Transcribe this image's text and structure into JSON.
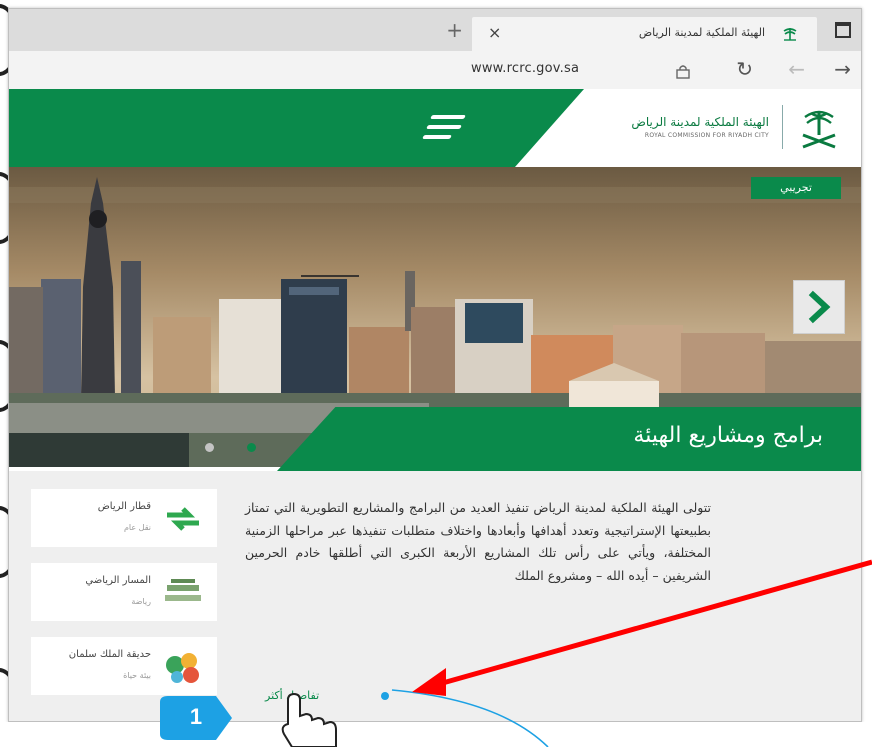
{
  "browser": {
    "tab_title": "الهيئة الملكية لمدينة الرياض",
    "url": "www.rcrc.gov.sa",
    "close_glyph": "×",
    "newtab_glyph": "+",
    "nav_icons": [
      "forward-icon",
      "back-icon",
      "refresh-icon",
      "lock-icon"
    ]
  },
  "site": {
    "logo_ar": "الهيئة الملكية لمدينة الرياض",
    "logo_en": "ROYAL COMMISSION FOR RIYADH CITY",
    "hero_tag": "تجريبي",
    "banner_title": "برامج ومشاريع الهيئة",
    "paragraph": "تتولى الهيئة الملكية لمدينة الرياض تنفيذ العديد من البرامج والمشاريع التطويرية التي تمتاز بطبيعتها الإستراتيجية وتعدد أهدافها وأبعادها واختلاف متطلبات تنفيذها عبر مراحلها الزمنية المختلفة، ويأتي على رأس تلك المشاريع الأربعة الكبرى التي أطلقها خادم الحرمين الشريفين – أيده الله – ومشروع الملك",
    "more_link": "تفاصيل أكثر",
    "cards": [
      {
        "title": "قطار الرياض",
        "sub": "نقل عام"
      },
      {
        "title": "المسار الرياضي",
        "sub": "رياضة"
      },
      {
        "title": "حديقة الملك سلمان",
        "sub": "بيئة حياة"
      }
    ],
    "accent": "#0a8a4b"
  },
  "annotation": {
    "step_number": "1",
    "badge_color": "#1da1e4",
    "arrow_color": "#ff0000"
  }
}
